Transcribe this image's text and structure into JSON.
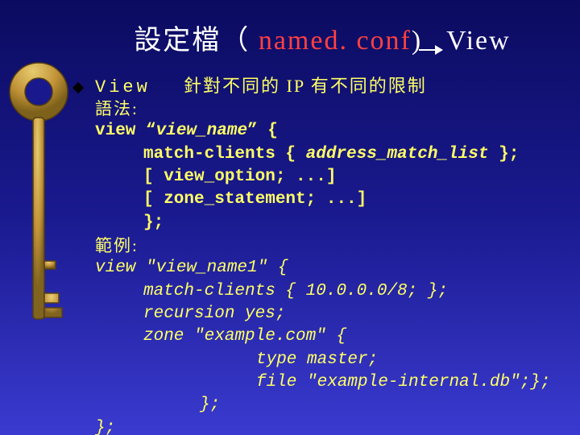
{
  "title": {
    "prefix": "設定檔（ ",
    "red": "named. conf",
    "suffix": " View"
  },
  "bulletLabel": "View",
  "bulletDesc": "針對不同的 IP 有不同的限制",
  "syntaxLabel": "語法:",
  "syntax": {
    "l1a": "view “",
    "l1b": "view_name",
    "l1c": "” {",
    "l2a": "match-clients { ",
    "l2b": "address_match_list",
    "l2c": " };",
    "l3a": "[ view_option",
    "l3b": "; ...]",
    "l4a": "[ zone_statement",
    "l4b": "; ...]",
    "l5": "};"
  },
  "exampleLabel": "範例:",
  "example": {
    "l1": "view \"view_name1\" {",
    "l2": "match-clients { 10.0.0.0/8; };",
    "l3": "recursion yes;",
    "l4": "zone \"example.com\" {",
    "l5": "type master;",
    "l6": "file \"example-internal.db\";};",
    "l7": "};",
    "l8": "};"
  }
}
